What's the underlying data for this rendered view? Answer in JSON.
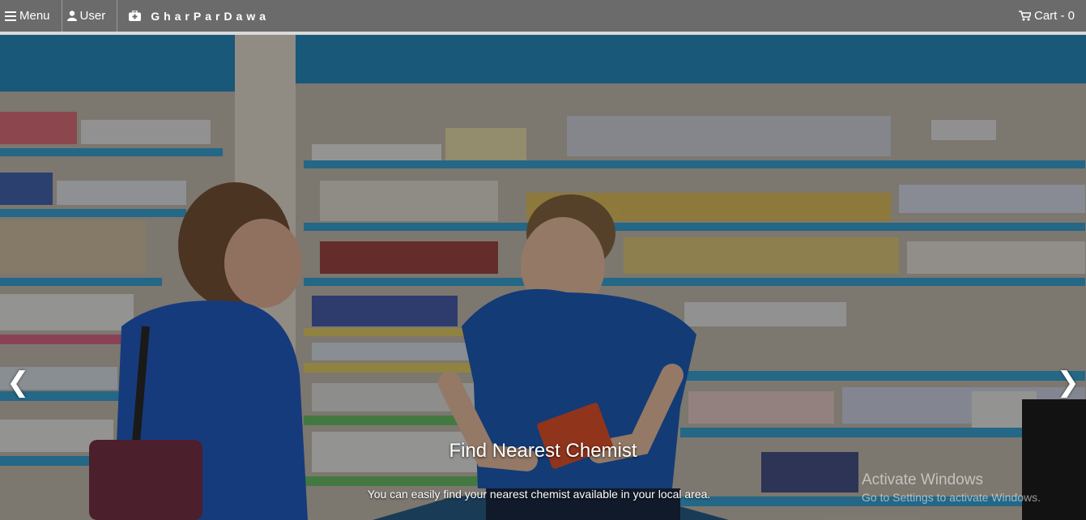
{
  "nav": {
    "menu_label": "Menu",
    "user_label": "User",
    "brand": "GharParDawa",
    "cart_label": "Cart - 0"
  },
  "icons": {
    "menu": "hamburger-icon",
    "user": "user-icon",
    "brand": "medkit-icon",
    "cart": "cart-icon",
    "prev": "chevron-left-icon",
    "next": "chevron-right-icon"
  },
  "hero": {
    "title": "Find Nearest Chemist",
    "subtitle": "You can easily find your nearest chemist available in your local area.",
    "prev_glyph": "❮",
    "next_glyph": "❯"
  },
  "watermark": {
    "line1": "Activate Windows",
    "line2": "Go to Settings to activate Windows."
  },
  "colors": {
    "navbar": "#6b6b6b",
    "shelf_accent": "#2fa3d8",
    "uniform": "#1f5fbf"
  }
}
